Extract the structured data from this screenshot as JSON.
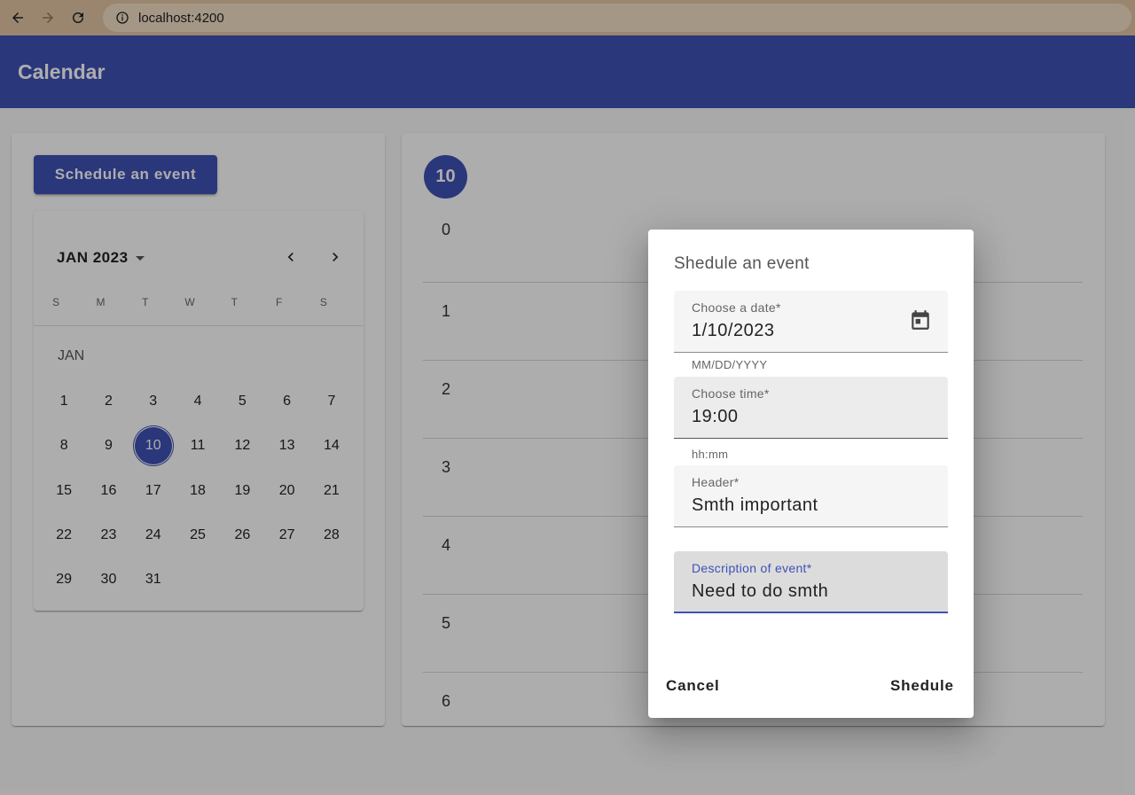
{
  "browser": {
    "url": "localhost:4200"
  },
  "app": {
    "title": "Calendar"
  },
  "sidebar": {
    "schedule_button": "Schedule an event",
    "mini_calendar": {
      "period_label": "JAN 2023",
      "weekdays": [
        "S",
        "M",
        "T",
        "W",
        "T",
        "F",
        "S"
      ],
      "month_label": "JAN",
      "days": [
        "1",
        "2",
        "3",
        "4",
        "5",
        "6",
        "7",
        "8",
        "9",
        "10",
        "11",
        "12",
        "13",
        "14",
        "15",
        "16",
        "17",
        "18",
        "19",
        "20",
        "21",
        "22",
        "23",
        "24",
        "25",
        "26",
        "27",
        "28",
        "29",
        "30",
        "31"
      ],
      "selected_day": "10"
    }
  },
  "day_view": {
    "day_number": "10",
    "hours": [
      "0",
      "1",
      "2",
      "3",
      "4",
      "5",
      "6"
    ]
  },
  "dialog": {
    "title": "Shedule an event",
    "date_field": {
      "label": "Choose a date*",
      "value": "1/10/2023",
      "hint": "MM/DD/YYYY"
    },
    "time_field": {
      "label": "Choose time*",
      "value": "19:00",
      "hint": "hh:mm"
    },
    "header_field": {
      "label": "Header*",
      "value": "Smth important"
    },
    "description_field": {
      "label": "Description of event*",
      "value": "Need to do smth"
    },
    "cancel_label": "Cancel",
    "submit_label": "Shedule"
  },
  "colors": {
    "primary": "#3f51b5",
    "browser_bar": "#e3c6a3"
  }
}
